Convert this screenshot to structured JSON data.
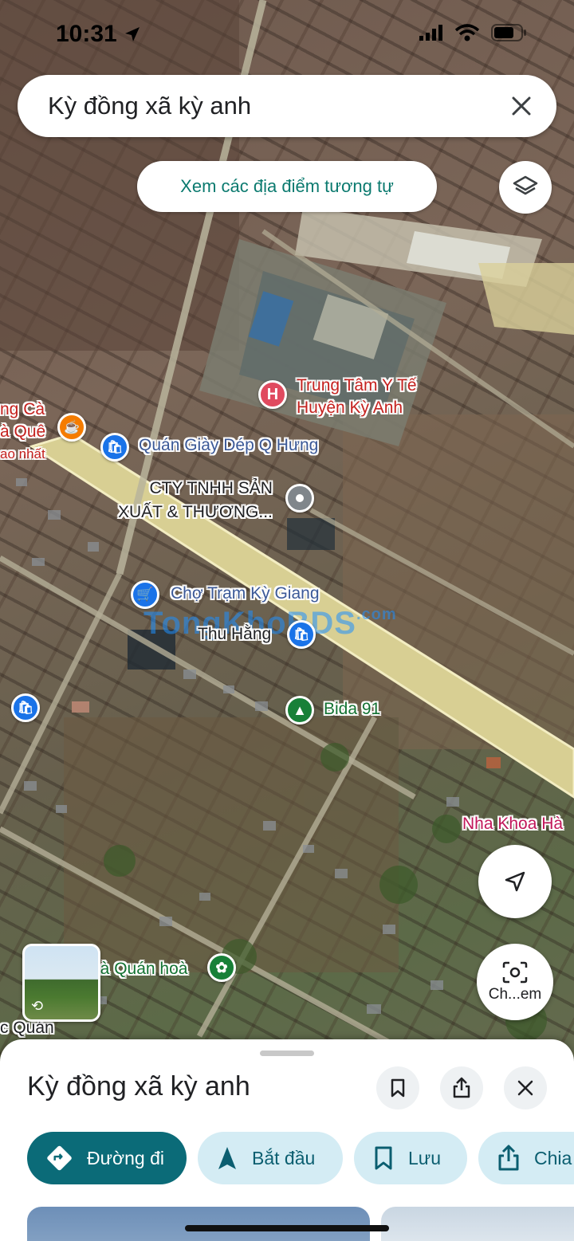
{
  "status_bar": {
    "time": "10:31"
  },
  "search": {
    "query": "Kỳ đồng xã kỳ anh"
  },
  "similar_places_button": "Xem các địa điểm tương tự",
  "map_labels": {
    "hospital": "Trung Tâm Y Tế\nHuyện Kỳ Anh",
    "cafe_partial_1": "ng Cà",
    "cafe_partial_2": "à Quê",
    "cafe_partial_3": "ao nhất",
    "shoe_shop": "Quán Giày Dép Q Hưng",
    "company": "CTY TNHH SẢN\nXUẤT & THƯƠNG...",
    "market": "Chợ Trạm Kỳ Giang",
    "thu_hang": "Thu Hằng",
    "bida": "Bida 91",
    "dental": "Nha Khoa Hà",
    "quan_hoa": "hà Quán hoà",
    "quan_partial": "c Quán"
  },
  "watermark": "TongKhoBDS",
  "watermark_suffix": ".com",
  "lens_button_label": "Ch...em",
  "sheet": {
    "title": "Kỳ đồng xã kỳ anh",
    "actions": [
      {
        "label": "Đường đi",
        "icon": "directions-icon"
      },
      {
        "label": "Bắt đầu",
        "icon": "navigation-arrow-icon"
      },
      {
        "label": "Lưu",
        "icon": "bookmark-icon"
      },
      {
        "label": "Chia",
        "icon": "share-icon"
      }
    ]
  },
  "colors": {
    "accent": "#0b6b78",
    "chip_bg": "#d4ecf4",
    "hospital_pin": "#e04a5f",
    "shop_pin": "#1a73e8",
    "cafe_pin": "#f57c00",
    "green_pin": "#188038"
  }
}
